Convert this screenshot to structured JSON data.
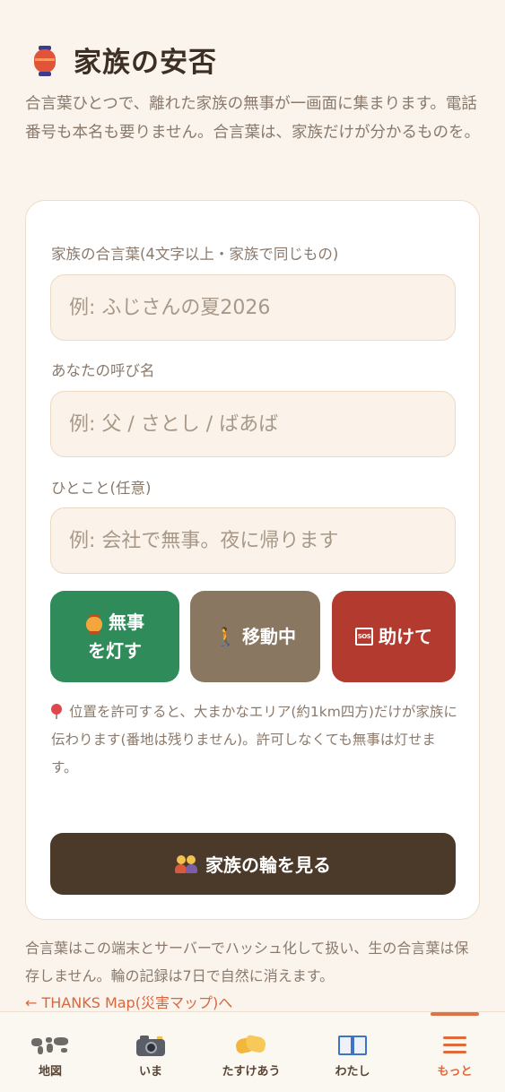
{
  "header": {
    "icon": "red-lantern-icon",
    "title": "家族の安否",
    "intro": "合言葉ひとつで、離れた家族の無事が一画面に集まります。電話番号も本名も要りません。合言葉は、家族だけが分かるものを。"
  },
  "form": {
    "passphrase_label": "家族の合言葉(4文字以上・家族で同じもの)",
    "passphrase_placeholder": "例: ふじさんの夏2026",
    "name_label": "あなたの呼び名",
    "name_placeholder": "例: 父 / さとし / ばあば",
    "message_label": "ひとこと(任意)",
    "message_placeholder": "例: 会社で無事。夜に帰ります"
  },
  "status_buttons": {
    "safe": {
      "line1": "無事",
      "line2": "を灯す",
      "icon": "lantern-icon",
      "color": "#2f8c5a"
    },
    "moving": {
      "label": "移動中",
      "icon": "walking-person-icon",
      "color": "#8a7762"
    },
    "help": {
      "label": "助けて",
      "icon": "sos-icon",
      "color": "#b23a2f"
    }
  },
  "location_note": {
    "icon": "pin-icon",
    "text": "位置を許可すると、大まかなエリア(約1km四方)だけが家族に伝わります(番地は残りません)。許可しなくても無事は灯せます。"
  },
  "ring_button": {
    "label": "家族の輪を見る",
    "icon": "family-icon"
  },
  "footer": {
    "privacy_note": "合言葉はこの端末とサーバーでハッシュ化して扱い、生の合言葉は保存しません。輪の記録は7日で自然に消えます。",
    "back_link": "← THANKS Map(災害マップ)へ"
  },
  "tabbar": {
    "items": [
      {
        "label": "地図",
        "icon": "world-map-icon"
      },
      {
        "label": "いま",
        "icon": "camera-icon"
      },
      {
        "label": "たすけあう",
        "icon": "handshake-icon"
      },
      {
        "label": "わたし",
        "icon": "book-icon"
      },
      {
        "label": "もっと",
        "icon": "menu-icon"
      }
    ],
    "active_index": 4,
    "active_color": "#e06a3c"
  }
}
